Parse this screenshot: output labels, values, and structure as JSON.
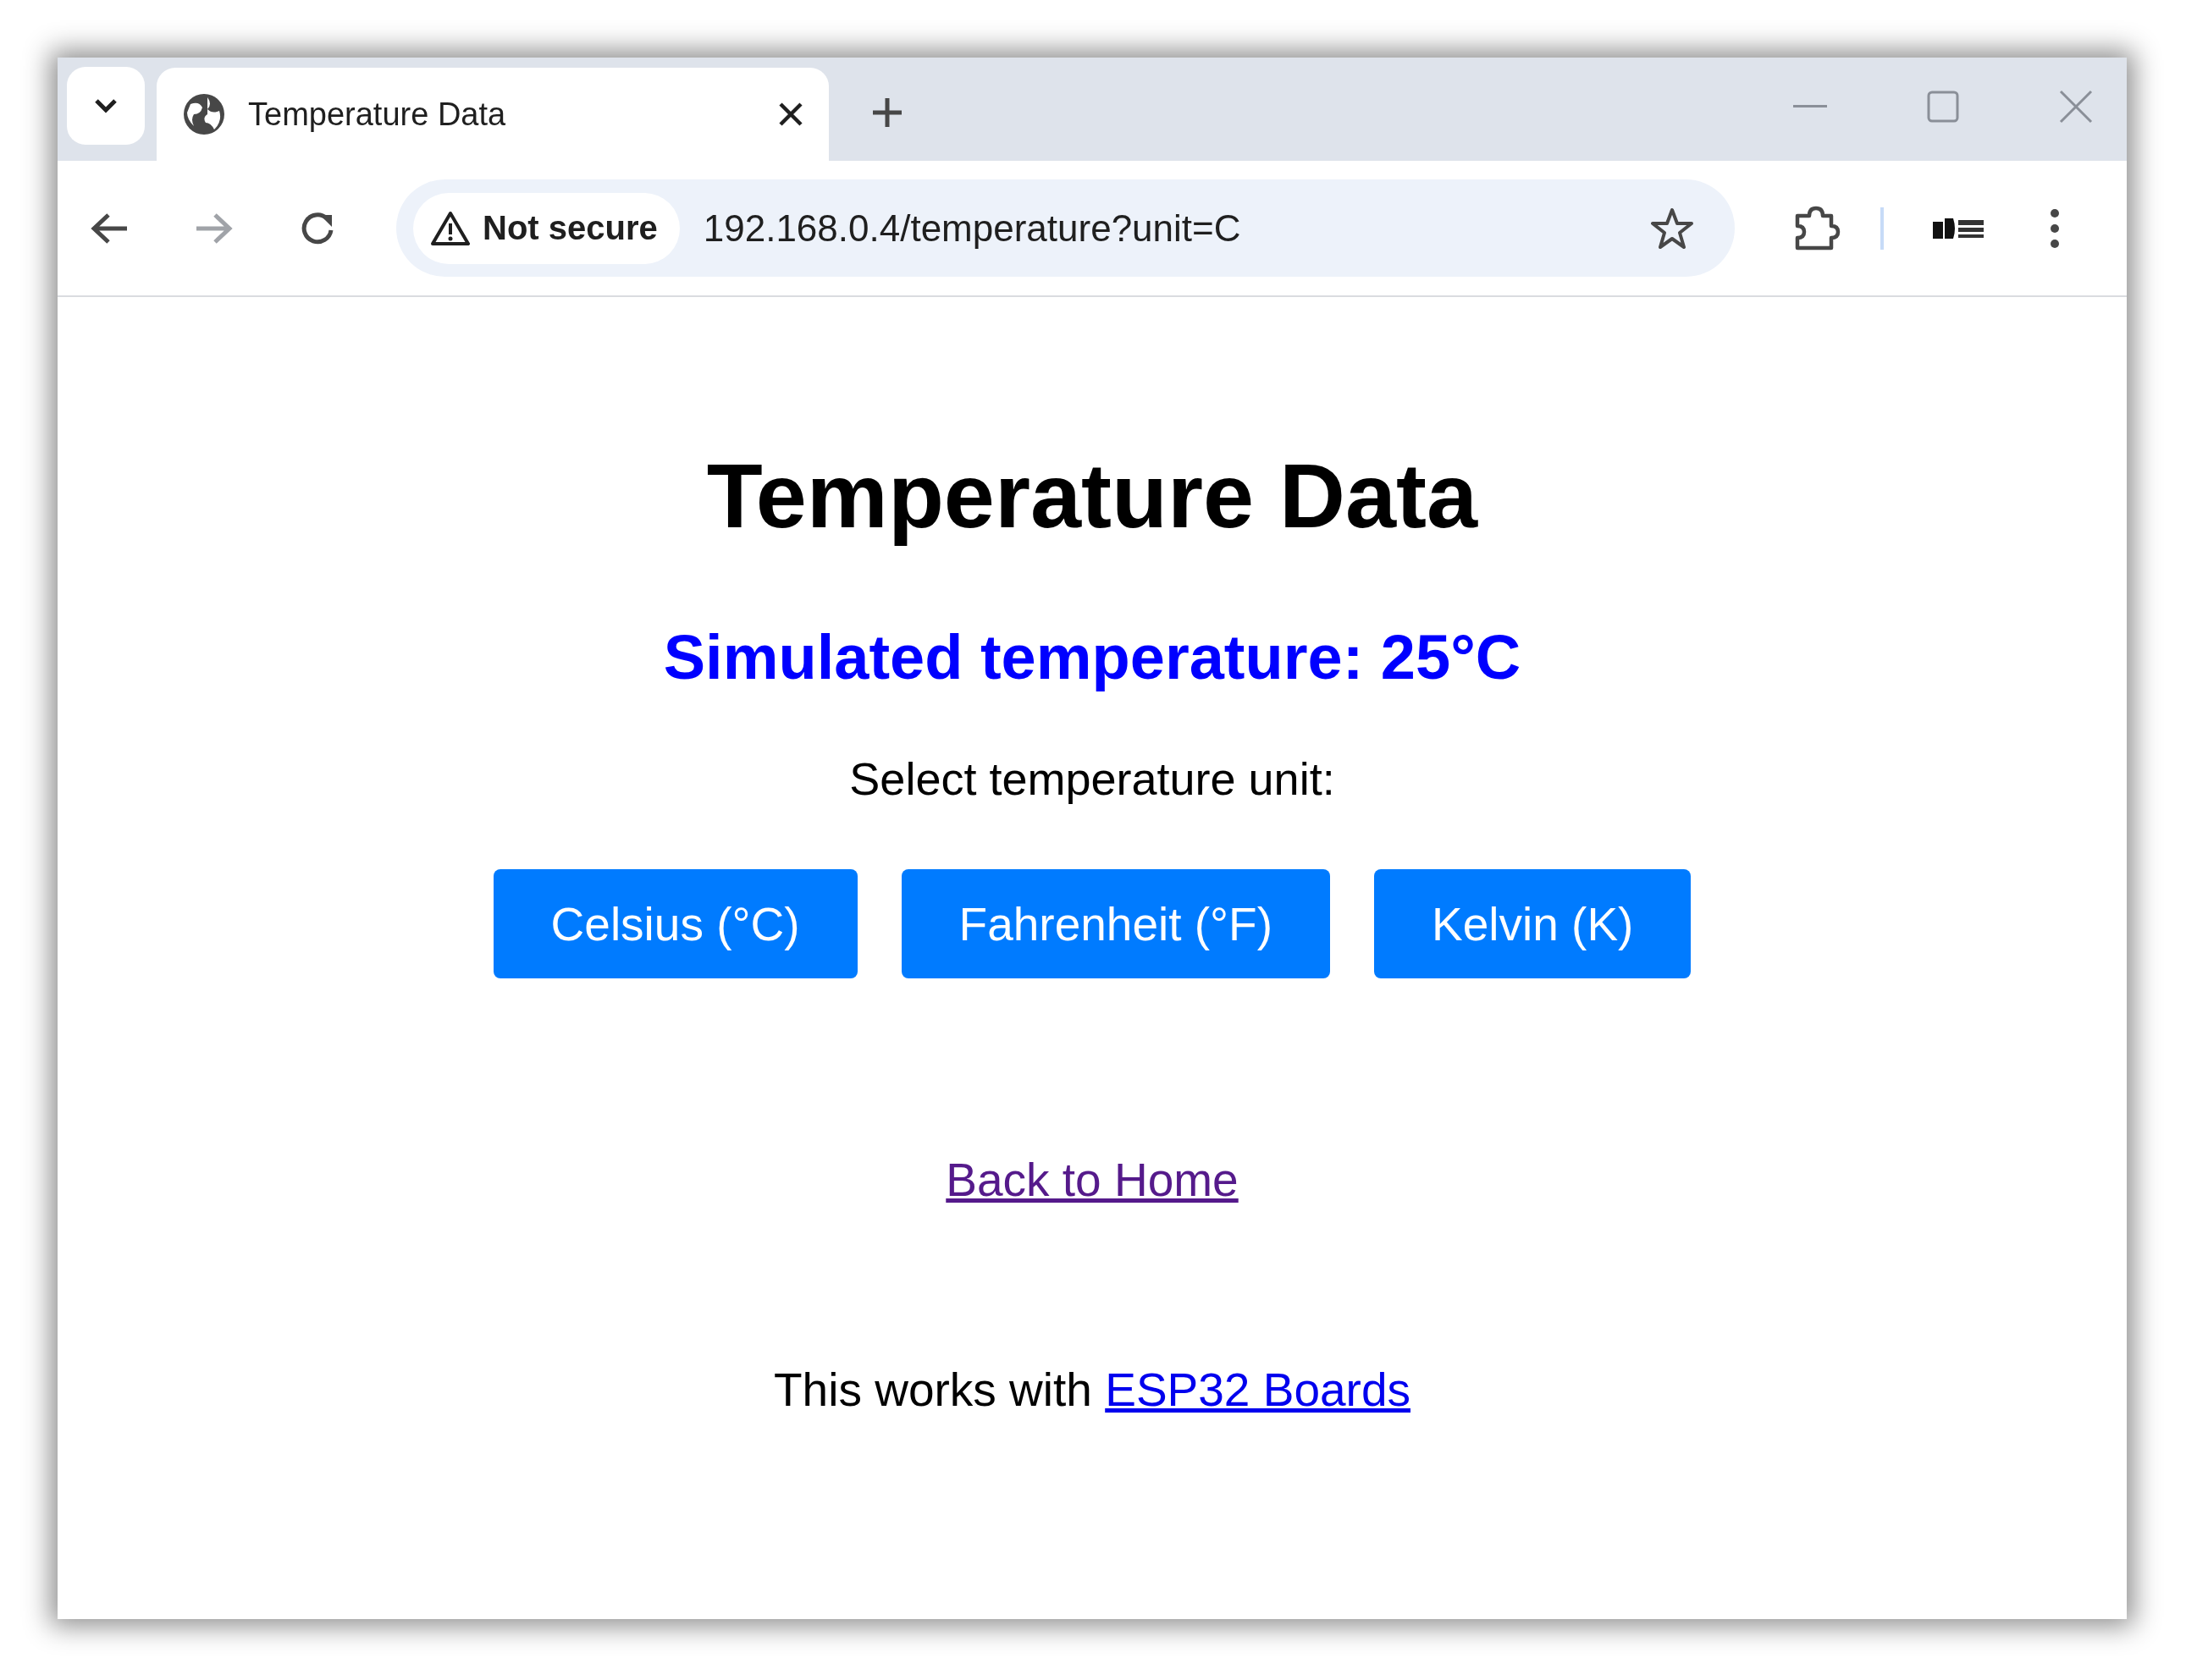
{
  "browser": {
    "tab_title": "Temperature Data",
    "security": "Not secure",
    "url": "192.168.0.4/temperature?unit=C"
  },
  "page": {
    "title": "Temperature Data",
    "reading": "Simulated temperature: 25°C",
    "prompt": "Select temperature unit:",
    "buttons": [
      {
        "label": "Celsius (°C)"
      },
      {
        "label": "Fahrenheit (°F)"
      },
      {
        "label": "Kelvin (K)"
      }
    ],
    "back_link": "Back to Home",
    "footer": {
      "text": "This works with",
      "link": "ESP32 Boards"
    }
  }
}
